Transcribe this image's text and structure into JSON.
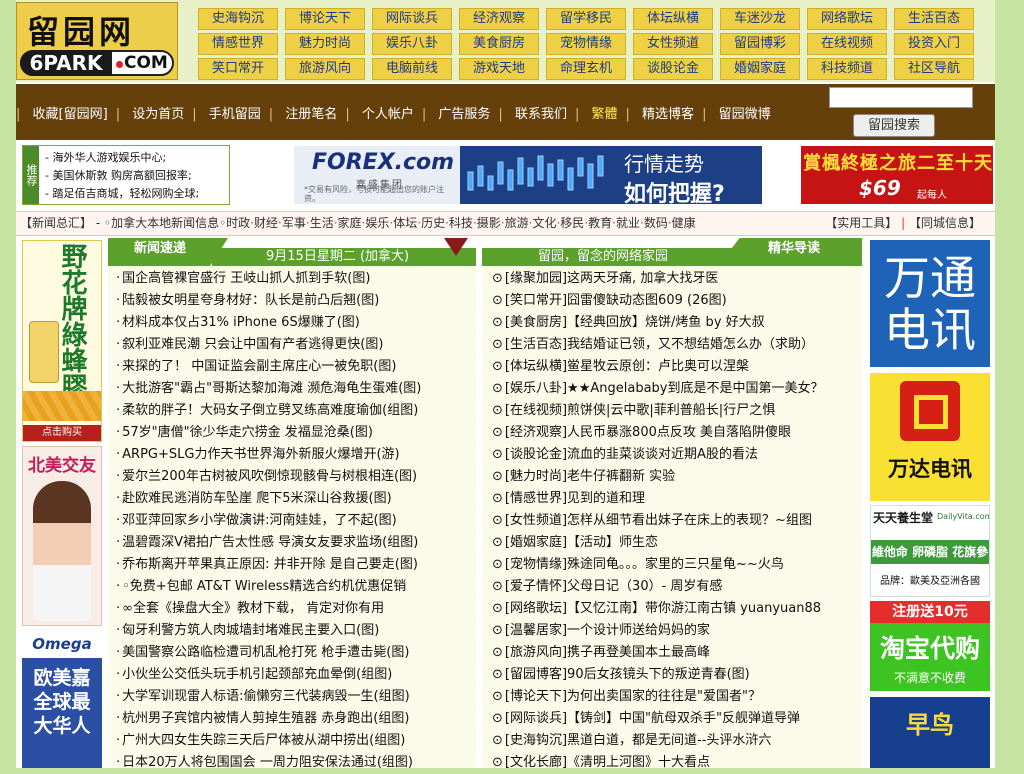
{
  "logo": {
    "cn": "留园网",
    "en_left": "6PARK",
    "en_right": "COM"
  },
  "categories": [
    [
      "史海钩沉",
      "博论天下",
      "网际谈兵",
      "经济观察",
      "留学移民",
      "体坛纵横",
      "车迷沙龙",
      "网络歌坛",
      "生活百态"
    ],
    [
      "情感世界",
      "魅力时尚",
      "娱乐八卦",
      "美食厨房",
      "宠物情缘",
      "女性频道",
      "留园博彩",
      "在线视频",
      "投资入门"
    ],
    [
      "笑口常开",
      "旅游风向",
      "电脑前线",
      "游戏天地",
      "命理玄机",
      "谈股论金",
      "婚姻家庭",
      "科技频道",
      "社区导航"
    ]
  ],
  "nav": {
    "links": [
      "收藏[留园网]",
      "设为首页",
      "手机留园",
      "注册笔名",
      "个人帐户",
      "广告服务",
      "联系我们",
      "繁體",
      "精选博客",
      "留园微博"
    ]
  },
  "search": {
    "placeholder": "",
    "button": "留园搜索"
  },
  "promo": {
    "tag": "推荐",
    "lines": [
      "- 海外华人游戏娱乐中心;",
      "- 美国休斯敦 购房高额回报率;",
      "- 踏足佰吉商城，轻松网购全球;"
    ]
  },
  "forex_ad": {
    "brand": "FOREX.com",
    "brand_cn": "嘉盛集团",
    "note": "*交易有风险，亏损可能超出您的账户注资。",
    "line1": "行情走势",
    "line2": "如何把握?"
  },
  "travel_ad": {
    "line1": "賞楓終極之旅二至十天",
    "price": "$69",
    "unit": "起每人"
  },
  "strip": {
    "left_label": "【新闻总汇】",
    "items": [
      "◦加拿大本地新闻信息◦",
      "时政",
      "财经",
      "军事",
      "生活",
      "家庭",
      "娱乐",
      "体坛",
      "历史",
      "科技",
      "摄影",
      "旅游",
      "文化",
      "移民",
      "教育",
      "就业",
      "数码",
      "健康"
    ],
    "right": [
      "【实用工具】",
      "【同城信息】"
    ]
  },
  "left_ads": {
    "honey": {
      "text": "野花牌綠蜂膠",
      "button": "点击购买"
    },
    "beimei": {
      "text": "北美交友"
    },
    "omega": {
      "text": "Omega",
      "big": "欧美嘉全球最大华人"
    }
  },
  "right_ads": {
    "wantong": "万通电讯",
    "wanda": "万达电讯",
    "vita": {
      "title": "天天養生堂",
      "site": "DailyVita.com",
      "line2": "維他命 卵磷脂 花旗參",
      "line3": "品牌：歐美及亞洲各國"
    },
    "taobao": {
      "tag": "注册送10元",
      "main": "淘宝代购",
      "sub": "不满意不收费"
    },
    "zaoniao": "早鸟"
  },
  "col1": {
    "header_left": "新闻速递",
    "header_date": "9月15日星期二 (加拿大)",
    "items": [
      "国企高管裸官盛行 王岐山抓人抓到手软(图)",
      "陆毅被女明星夸身材好：队长是前凸后翘(图)",
      "材料成本仅占31% iPhone 6S爆赚了(图)",
      "叙利亚难民潮 只会让中国有产者逃得更快(图)",
      "来探的了！ 中国证监会副主席庄心一被免职(图)",
      "大批游客\"霸占\"哥斯达黎加海滩 濒危海龟生蛋难(图)",
      "柔软的胖子！大码女子倒立劈叉练高难度瑜伽(组图)",
      "57岁\"唐僧\"徐少华走穴捞金 发福显沧桑(图)",
      "ARPG+SLG力作天书世界海外新服火爆增开(游)",
      "爱尔兰200年古树被风吹倒惊现骸骨与树根相连(图)",
      "赴欧难民逃消防车坠崖 爬下5米深山谷救援(图)",
      "邓亚萍回家乡小学做演讲:河南娃娃，了不起(图)",
      "温碧霞深V裙拍广告太性感 导演女友要求监场(组图)",
      "乔布斯离开苹果真正原因: 并非开除 是自己要走(图)",
      "◦免费+包邮 AT&T Wireless精选合约机优惠促销",
      "∞全套《操盘大全》教材下载， 肯定对你有用",
      "匈牙利警方筑人肉城墙封堵难民主要入口(图)",
      "美国警察公路临检遭司机乱枪打死 枪手遭击毙(图)",
      "小伙坐公交低头玩手机引起颈部充血晕倒(组图)",
      "大学军训现雷人标语:偷懒穷三代装病毁一生(组图)",
      "杭州男子宾馆内被情人剪掉生殖器 赤身跑出(组图)",
      "广州大四女生失踪三天后尸体被从湖中捞出(组图)",
      "日本20万人将包围国会 一周力阻安保法通过(组图)"
    ]
  },
  "col2": {
    "header_left": "留园，留念的网络家园",
    "header_right": "精华导读",
    "items": [
      "[缘聚加园]这两天牙痛, 加拿大找牙医",
      "[笑口常开]囧雷傻缺动态图609 (26图)",
      "[美食厨房]【经典回放】烧饼/烤鱼 by 好大叔",
      "[生活百态]我结婚证已领，又不想结婚怎么办（求助）",
      "[体坛纵横]鲎星牧云原创：卢比奥可以涅槃",
      "[娱乐八卦]★★Angelababy到底是不是中国第一美女？",
      "[在线视频]煎饼侠|云中歌|菲利普船长|行尸之惧",
      "[经济观察]人民币暴涨800点反攻 美自落陷阱傻眼",
      "[谈股论金]流血的韭菜谈谈对近期A股的看法",
      "[魅力时尚]老牛仔裤翻新 实验",
      "[情感世界]见到的道和理",
      "[女性频道]怎样从细节看出妹子在床上的表现？~组图",
      "[婚姻家庭]【活动】师生恋",
      "[宠物情缘]殊途同龟。。。家里的三只星龟~~火鸟",
      "[爱子情怀]父母日记（30）- 周岁有感",
      "[网络歌坛]【又忆江南】带你游江南古镇 yuanyuan88",
      "[温馨居家]一个设计师送给妈妈的家",
      "[旅游风向]携子再登美国本土最高峰",
      "[留园博客]90后女孩镜头下的叛逆青春(图)",
      "[博论天下]为何出卖国家的往往是\"爱国者\"？",
      "[网际谈兵]【铸剑】中国\"航母双杀手\"反舰弹道导弹",
      "[史海钩沉]黑道白道，都是无间道--头评水浒六",
      "[文化长廊]《清明上河图》十大看点"
    ]
  }
}
